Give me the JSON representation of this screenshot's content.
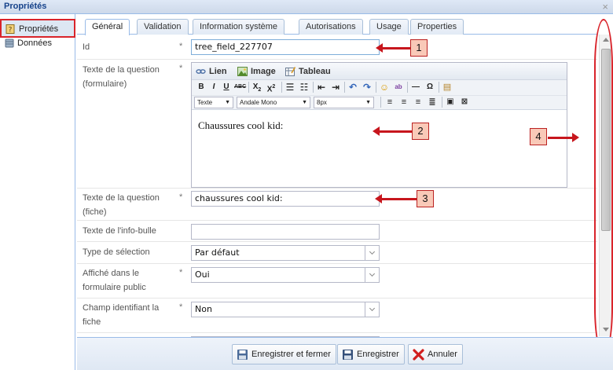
{
  "window": {
    "title": "Propriétés"
  },
  "sidebar": {
    "items": [
      {
        "label": "Propriétés",
        "icon": "properties-icon"
      },
      {
        "label": "Données",
        "icon": "database-icon"
      }
    ]
  },
  "tabs": [
    {
      "label": "Général"
    },
    {
      "label": "Validation"
    },
    {
      "label": "Information système"
    },
    {
      "label": "Autorisations"
    },
    {
      "label": "Usage"
    },
    {
      "label": "Properties"
    }
  ],
  "form": {
    "required_mark": "*",
    "id": {
      "label": "Id",
      "value": "tree_field_227707"
    },
    "question_form": {
      "label": "Texte de la question (formulaire)",
      "content": "Chaussures cool kid:"
    },
    "editor": {
      "link": "Lien",
      "image": "Image",
      "table": "Tableau",
      "style_select": "Texte",
      "font_select": "Andale Mono",
      "size_select": "8px"
    },
    "question_fiche": {
      "label": "Texte de la question (fiche)",
      "value": "chaussures cool kid:"
    },
    "tooltip": {
      "label": "Texte de l'info-bulle",
      "value": ""
    },
    "selection_type": {
      "label": "Type de sélection",
      "value": "Par défaut"
    },
    "public_form": {
      "label": "Affiché dans le formulaire public",
      "value": "Oui"
    },
    "identifier": {
      "label": "Champ identifiant la fiche",
      "value": "Non"
    }
  },
  "footer": {
    "save_close": "Enregistrer et fermer",
    "save": "Enregistrer",
    "cancel": "Annuler"
  },
  "callouts": [
    "1",
    "2",
    "3",
    "4"
  ],
  "colors": {
    "accent": "#99bbe8",
    "highlight": "#d9242b",
    "callout_fill": "#f9c9b8"
  }
}
